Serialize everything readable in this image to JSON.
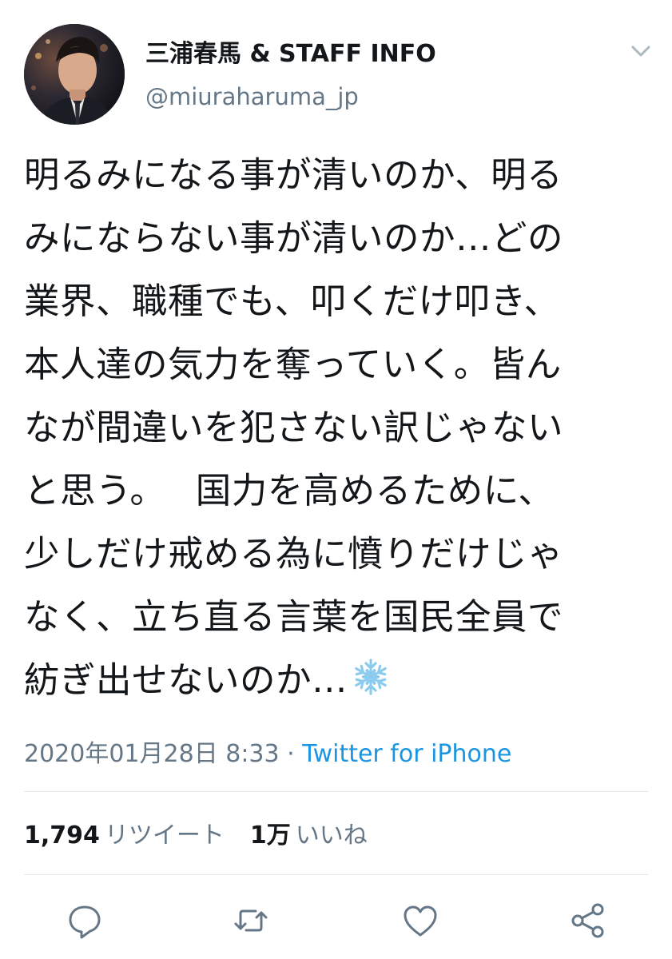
{
  "user": {
    "display_name": "三浦春馬 & STAFF INFO",
    "handle": "@miuraharuma_jp"
  },
  "tweet": {
    "lines": [
      "明るみになる事が清いのか、明る",
      "みにならない事が清いのか…どの",
      "業界、職種でも、叩くだけ叩き、",
      "本人達の気力を奪っていく。皆ん",
      "なが間違いを犯さない訳じゃない",
      "と思う。　 国力を高めるために、",
      "少しだけ戒める為に憤りだけじゃ",
      "なく、立ち直る言葉を国民全員で",
      "紡ぎ出せないのか…"
    ],
    "emoji_icon": "snowflake-emoji"
  },
  "meta": {
    "timestamp": "2020年01月28日 8:33",
    "separator": " · ",
    "source": "Twitter for iPhone"
  },
  "stats": {
    "retweets_count": "1,794",
    "retweets_label": "リツイート",
    "likes_count": "1万",
    "likes_label": "いいね"
  },
  "actions": [
    {
      "icon": "reply-icon"
    },
    {
      "icon": "retweet-icon"
    },
    {
      "icon": "like-icon"
    },
    {
      "icon": "share-icon"
    }
  ],
  "colors": {
    "text": "#14171a",
    "secondary": "#657786",
    "link": "#1b95e0",
    "divider": "#e1e8ed",
    "snowflake": "#8ccbf0"
  }
}
